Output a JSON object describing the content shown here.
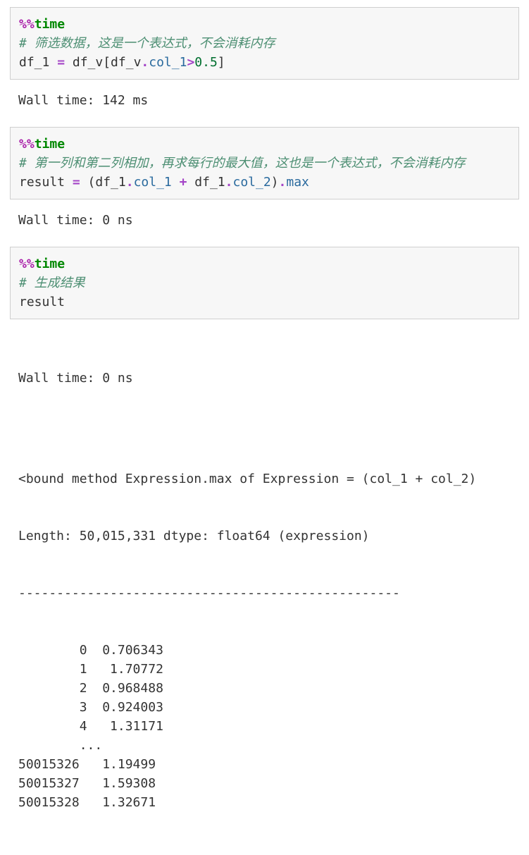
{
  "cell1": {
    "magic_pct": "%%",
    "magic_cmd": "time",
    "comment": "# 筛选数据，这是一个表达式，不会消耗内存",
    "code_lhs": "df_1 ",
    "code_eq": "=",
    "code_mid1": " df_v[df_v",
    "code_dot1": ".",
    "code_attr1": "col_1",
    "code_gt": ">",
    "code_num": "0.5",
    "code_tail": "]",
    "wall_time": "Wall time: 142 ms"
  },
  "cell2": {
    "magic_pct": "%%",
    "magic_cmd": "time",
    "comment": "# 第一列和第二列相加，再求每行的最大值，这也是一个表达式，不会消耗内存",
    "code_lhs": "result ",
    "code_eq": "=",
    "code_open": " (df_1",
    "code_dot1": ".",
    "code_attr1": "col_1",
    "code_plus": " + ",
    "code_mid2": "df_1",
    "code_dot2": ".",
    "code_attr2": "col_2",
    "code_close": ")",
    "code_dot3": ".",
    "code_attr3": "max",
    "wall_time": "Wall time: 0 ns"
  },
  "cell3": {
    "magic_pct": "%%",
    "magic_cmd": "time",
    "comment": "# 生成结果",
    "code": "result",
    "wall_time": "Wall time: 0 ns",
    "out_line1": "<bound method Expression.max of Expression = (col_1 + col_2)",
    "out_line2": "Length: 50,015,331 dtype: float64 (expression)",
    "divider": "--------------------------------------------------",
    "rows": [
      "        0  0.706343",
      "        1   1.70772",
      "        2  0.968488",
      "        3  0.924003",
      "        4   1.31171",
      "        ...         ",
      "50015326   1.19499",
      "50015327   1.59308",
      "50015328   1.32671"
    ]
  }
}
